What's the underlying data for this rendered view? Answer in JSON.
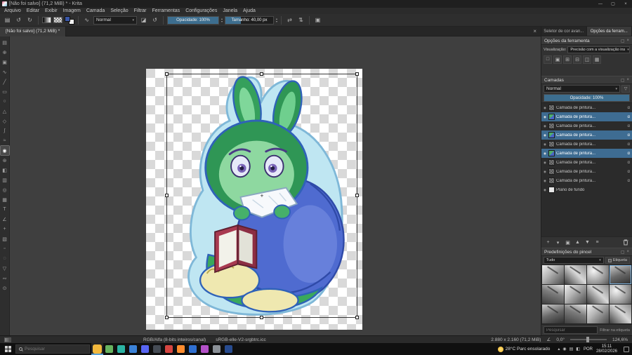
{
  "colors": {
    "selection_blue": "#3e6c92",
    "slider_fill": "#3d6e8f",
    "canvas_gray": "#3f3f3f"
  },
  "icons": {
    "minimize": "—",
    "maximize": "▢",
    "close": "×",
    "chevron_down": "▾",
    "chevron_up": "▴",
    "eye": "◉",
    "alpha": "α",
    "funnel": "▽",
    "plus": "+",
    "duplicate": "▣",
    "arrow_up": "▲",
    "arrow_down": "▼",
    "properties": "≡",
    "eraser": "◪",
    "undo": "↺",
    "redo": "↻",
    "grid": "▤",
    "brush": "∿",
    "mirror_h": "⇄",
    "mirror_v": "⇅",
    "crop": "▣",
    "angle": "∠",
    "center_mark": "+"
  },
  "window": {
    "title": "[Não foi salvo]  (71,2 MiB) * - Krita"
  },
  "menu_bar": {
    "items": [
      "Arquivo",
      "Editar",
      "Exibir",
      "Imagem",
      "Camada",
      "Seleção",
      "Filtrar",
      "Ferramentas",
      "Configurações",
      "Janela",
      "Ajuda"
    ]
  },
  "toolbar": {
    "blend_mode": "Normal",
    "opacity_label": "Opacidade: 100%",
    "opacity_percent": 100,
    "size_label": "Tamanho: 40,00 px",
    "size_percent": 33
  },
  "doc_tab": {
    "label": "[Não foi salvo]  (71,2 MiB) *"
  },
  "toolbox": {
    "active_index": 11,
    "tools": [
      {
        "name": "shape-select",
        "glyph": "▤"
      },
      {
        "name": "move",
        "glyph": "⊕"
      },
      {
        "name": "crop",
        "glyph": "▣"
      },
      {
        "name": "freehand-brush",
        "glyph": "∿"
      },
      {
        "name": "line",
        "glyph": "╱"
      },
      {
        "name": "rectangle",
        "glyph": "▭"
      },
      {
        "name": "ellipse",
        "glyph": "○"
      },
      {
        "name": "polygon",
        "glyph": "△"
      },
      {
        "name": "polyline",
        "glyph": "◇"
      },
      {
        "name": "bezier",
        "glyph": "∫"
      },
      {
        "name": "freehand-path",
        "glyph": "≈"
      },
      {
        "name": "transform",
        "glyph": "◉"
      },
      {
        "name": "multibrush",
        "glyph": "⊛"
      },
      {
        "name": "fill",
        "glyph": "◧"
      },
      {
        "name": "gradient",
        "glyph": "▥"
      },
      {
        "name": "color-sampler",
        "glyph": "◎"
      },
      {
        "name": "pattern-edit",
        "glyph": "▦"
      },
      {
        "name": "text",
        "glyph": "T"
      },
      {
        "name": "measure",
        "glyph": "∠"
      },
      {
        "name": "assistants",
        "glyph": "+"
      },
      {
        "name": "reference-images",
        "glyph": "▧"
      },
      {
        "name": "rect-select",
        "glyph": "▫"
      },
      {
        "name": "ellipse-select",
        "glyph": "◌"
      },
      {
        "name": "polygon-select",
        "glyph": "▽"
      },
      {
        "name": "freehand-select",
        "glyph": "∾"
      },
      {
        "name": "zoom",
        "glyph": "⊙"
      }
    ]
  },
  "right_panel": {
    "tabs": [
      {
        "label": "Seletor de cor avan...",
        "active": false
      },
      {
        "label": "Opções da ferram...",
        "active": true
      }
    ],
    "tool_options": {
      "title": "Opções da ferramenta",
      "view_label": "Visualização:",
      "view_value": "Precisão com a visualização ins"
    },
    "layers": {
      "title": "Camadas",
      "blend_mode": "Normal",
      "opacity_label": "Opacidade: 100%",
      "rows": [
        {
          "label": "Camada de pintura...",
          "selected": false,
          "thumb": "dim",
          "alpha": true
        },
        {
          "label": "Camada de pintura...",
          "selected": true,
          "thumb": "art",
          "alpha": true
        },
        {
          "label": "Camada de pintura...",
          "selected": false,
          "thumb": "dim",
          "alpha": true
        },
        {
          "label": "Camada de pintura...",
          "selected": true,
          "thumb": "art",
          "alpha": true
        },
        {
          "label": "Camada de pintura...",
          "selected": false,
          "thumb": "dim",
          "alpha": true
        },
        {
          "label": "Camada de pintura...",
          "selected": true,
          "thumb": "art",
          "alpha": true
        },
        {
          "label": "Camada de pintura...",
          "selected": false,
          "thumb": "dim",
          "alpha": true
        },
        {
          "label": "Camada de pintura...",
          "selected": false,
          "thumb": "dim",
          "alpha": true
        },
        {
          "label": "Camada de pintura...",
          "selected": false,
          "thumb": "dim",
          "alpha": true
        },
        {
          "label": "Plano de fundo",
          "selected": false,
          "thumb": "white",
          "alpha": false
        }
      ]
    },
    "brushes": {
      "title": "Predefinições do pincel",
      "filter_value": "Tudo",
      "tag_label": "Etiqueta",
      "search_placeholder": "Pesquisar",
      "filter_hint": "Filtrar na etiqueta",
      "tile_count": 12,
      "selected_index": 3
    }
  },
  "status_bar": {
    "color_mode": "RGB/Alfa (8-bits inteiros/canal)",
    "profile": "sRGB-elle-V2-srgbtrc.icc",
    "dimensions": "2.880 x 2.160 (71,2 MiB)",
    "angle": "0,0°",
    "zoom": "124,6%"
  },
  "taskbar": {
    "search_placeholder": "Pesquisar",
    "apps": [
      {
        "color": "#f2b83c",
        "big": true,
        "active": true
      },
      {
        "color": "#67b35f"
      },
      {
        "color": "#2bb3a3"
      },
      {
        "color": "#3b82d8"
      },
      {
        "color": "#5865f2"
      },
      {
        "color": "#454b54"
      },
      {
        "color": "#d64541"
      },
      {
        "color": "#ff8c2e"
      },
      {
        "color": "#2f6fd0"
      },
      {
        "color": "#b350c8"
      },
      {
        "color": "#8a9097"
      },
      {
        "color": "#274b8f"
      }
    ],
    "weather": "28°C  Parc ensolarado",
    "tray_icons": [
      "▴",
      "◉",
      "▤",
      "◧"
    ],
    "lang": "POR",
    "time": "15:11",
    "date": "28/02/2026"
  }
}
